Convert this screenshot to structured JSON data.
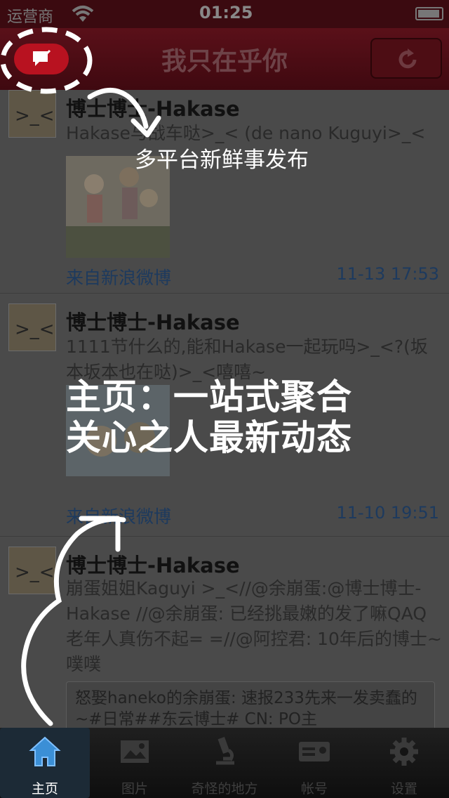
{
  "status": {
    "carrier": "运营商",
    "time": "01:25"
  },
  "navbar": {
    "title": "我只在乎你"
  },
  "posts": [
    {
      "author": "博士博士-Hakase",
      "text": "Hakase与战车哒>_< (de nano Kuguyi>_<",
      "source": "来自新浪微博",
      "time": "11-13 17:53"
    },
    {
      "author": "博士博士-Hakase",
      "text": "1111节什么的,能和Hakase一起玩吗>_<?(坂本坂本也在哒)>_<嘻嘻~",
      "source": "来自新浪微博",
      "time": "11-10 19:51"
    },
    {
      "author": "博士博士-Hakase",
      "text": "崩蛋姐姐Kaguyi >_<//@余崩蛋:@博士博士-Hakase //@余崩蛋: 已经挑最嫩的发了嘛QAQ老年人真伤不起= =//@阿控君: 10年后的博士~噗噗",
      "quote": "怒娶haneko的余崩蛋: 速报233先来一发卖蠢的~#日常##东云博士# CN: PO主"
    }
  ],
  "overlay": {
    "hint_compose": "多平台新鲜事发布",
    "hint_home_line1": "主页：一站式聚合",
    "hint_home_line2": "关心之人最新动态"
  },
  "tabs": [
    {
      "label": "主页",
      "icon": "home-icon"
    },
    {
      "label": "图片",
      "icon": "photo-icon"
    },
    {
      "label": "奇怪的地方",
      "icon": "microscope-icon"
    },
    {
      "label": "帐号",
      "icon": "id-card-icon"
    },
    {
      "label": "设置",
      "icon": "gear-icon"
    }
  ],
  "colors": {
    "navbar": "#4a0c14",
    "compose_button": "#b81220",
    "active_tab": "#3b8fd6"
  }
}
